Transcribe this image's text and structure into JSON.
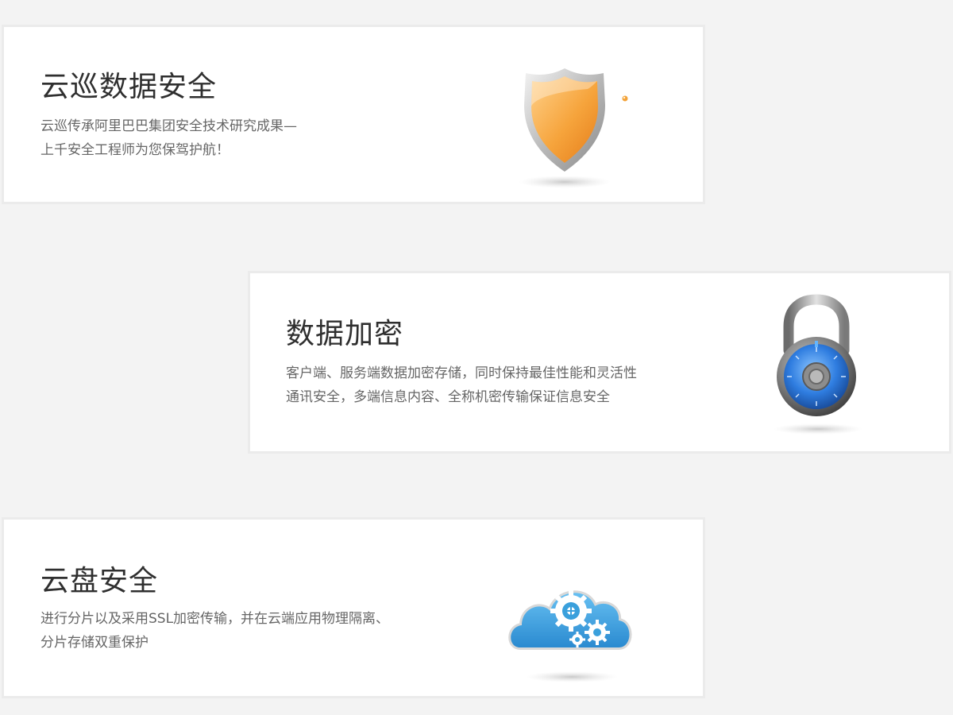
{
  "cards": [
    {
      "title": "云巡数据安全",
      "desc_lines": [
        "云巡传承阿里巴巴集团安全技术研究成果—",
        "上千安全工程师为您保驾护航！"
      ],
      "icon": "shield-icon"
    },
    {
      "title": "数据加密",
      "desc_lines": [
        "客户端、服务端数据加密存储，同时保持最佳性能和灵活性",
        "通讯安全，多端信息内容、全称机密传输保证信息安全"
      ],
      "icon": "padlock-icon"
    },
    {
      "title": "云盘安全",
      "desc_lines": [
        "进行分片以及采用SSL加密传输，并在云端应用物理隔离、",
        "分片存储双重保护"
      ],
      "icon": "cloud-gears-icon"
    }
  ],
  "colors": {
    "background": "#f3f3f3",
    "card": "#ffffff",
    "title": "#2f2f2f",
    "text": "#666666",
    "shield": "#f3a33a",
    "lock_dial": "#2f7de0",
    "cloud": "#3aa0dc"
  }
}
